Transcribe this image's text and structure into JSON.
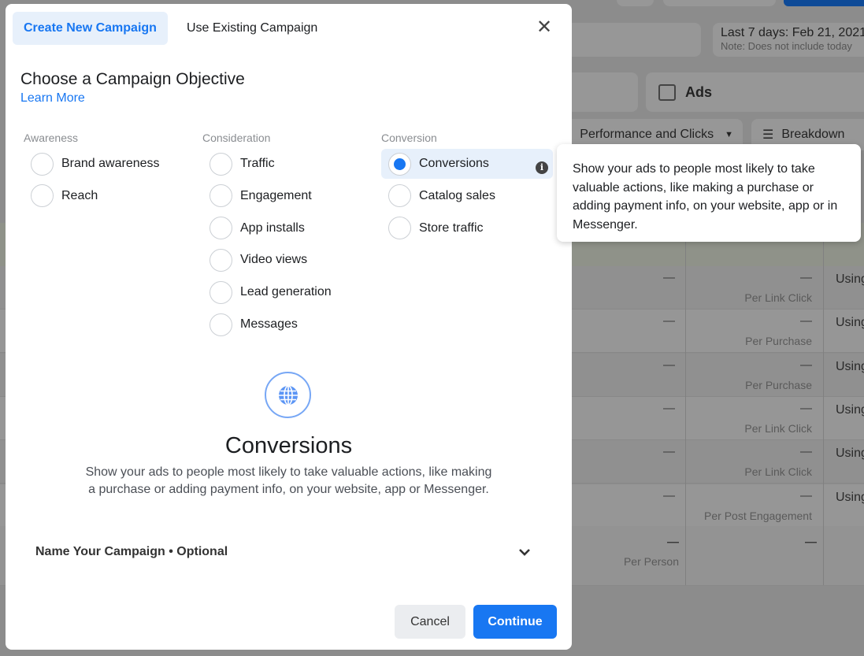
{
  "background": {
    "date_range": "Last 7 days: Feb 21, 2021",
    "date_note": "Note: Does not include today",
    "ads_tab": "Ads",
    "columns_dropdown": "Performance and Clicks",
    "breakdown": "Breakdown",
    "rows": [
      {
        "a": "—",
        "b": "—",
        "b_sub": "Per Link Click",
        "c": "Using"
      },
      {
        "a": "—",
        "b": "—",
        "b_sub": "Per Purchase",
        "c": "Using"
      },
      {
        "a": "—",
        "b": "—",
        "b_sub": "Per Purchase",
        "c": "Using"
      },
      {
        "a": "—",
        "b": "—",
        "b_sub": "Per Link Click",
        "c": "Using"
      },
      {
        "a": "—",
        "b": "—",
        "b_sub": "Per Link Click",
        "c": "Using"
      },
      {
        "a": "—",
        "b": "—",
        "b_sub": "Per Post Engagement",
        "c": "Using"
      }
    ],
    "total_row": {
      "a": "—",
      "a_sub": "Per Person",
      "b": "—"
    }
  },
  "modal": {
    "tabs": [
      {
        "label": "Create New Campaign",
        "active": true
      },
      {
        "label": "Use Existing Campaign",
        "active": false
      }
    ],
    "title": "Choose a Campaign Objective",
    "learn_more": "Learn More",
    "groups": [
      {
        "header": "Awareness",
        "options": [
          "Brand awareness",
          "Reach"
        ]
      },
      {
        "header": "Consideration",
        "options": [
          "Traffic",
          "Engagement",
          "App installs",
          "Video views",
          "Lead generation",
          "Messages"
        ]
      },
      {
        "header": "Conversion",
        "options": [
          "Conversions",
          "Catalog sales",
          "Store traffic"
        ]
      }
    ],
    "selected": "Conversions",
    "detail_icon": "globe-icon",
    "detail_title": "Conversions",
    "detail_desc": "Show your ads to people most likely to take valuable actions, like making a purchase or adding payment info, on your website, app or Messenger.",
    "name_section": "Name Your Campaign • Optional",
    "cancel": "Cancel",
    "continue": "Continue",
    "accent": "#1877f2"
  },
  "tooltip": "Show your ads to people most likely to take valuable actions, like making a purchase or adding payment info, on your website, app or in Messenger."
}
